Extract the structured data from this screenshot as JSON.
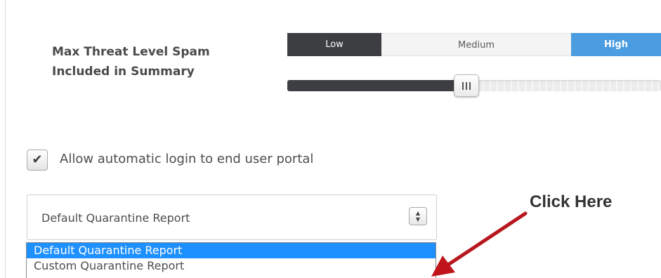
{
  "threat_level": {
    "label_line1": "Max Threat Level Spam",
    "label_line2": "Included in Summary",
    "levels": [
      "Low",
      "Medium",
      "High"
    ],
    "slider_value_percent": 48
  },
  "auto_login": {
    "label": "Allow automatic login to end user portal",
    "checked": true
  },
  "report_select": {
    "selected": "Default Quarantine Report",
    "options": [
      "Default Quarantine Report",
      "Custom Quarantine Report"
    ]
  },
  "annotation": {
    "text": "Click Here",
    "arrow_color": "#c0141c"
  },
  "colors": {
    "dark": "#3d3e42",
    "high": "#4a9de0",
    "option_highlight": "#1e90ff"
  },
  "icons": {
    "check": "check-icon",
    "select_arrows": "select-arrows-icon",
    "grip": "grip-icon"
  }
}
